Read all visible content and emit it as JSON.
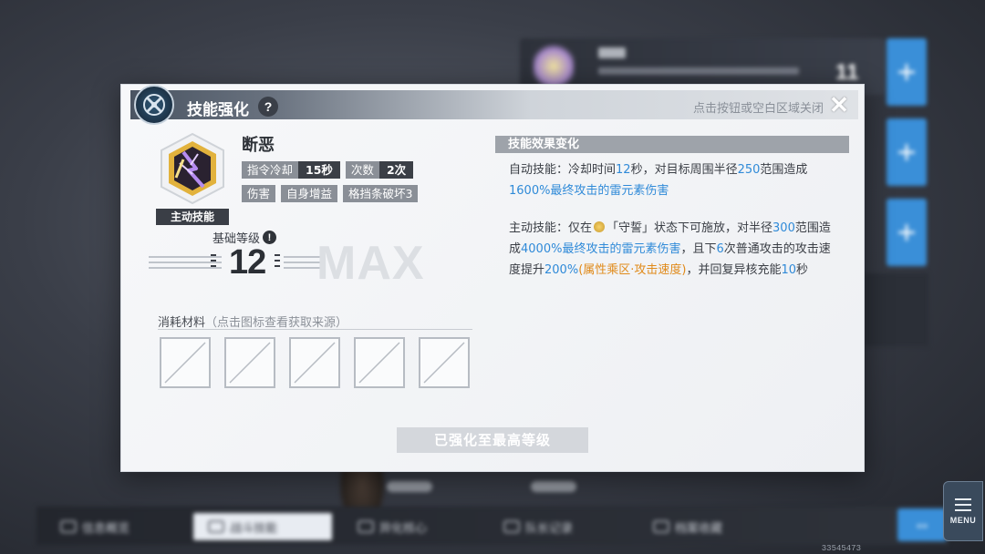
{
  "modal": {
    "title": "技能强化",
    "help_symbol": "?",
    "close_hint": "点击按钮或空白区域关闭",
    "close_symbol": "✕"
  },
  "skill": {
    "name": "断恶",
    "type_badge": "主动技能",
    "tags_row1": [
      {
        "key": "指令冷却",
        "value": "15秒"
      },
      {
        "key": "次数",
        "value": "2次"
      }
    ],
    "tags_row2": [
      "伤害",
      "自身增益",
      "格挡条破坏3"
    ],
    "level_label": "基础等级",
    "level_warn": "!",
    "level_value": "12",
    "level_max": "MAX"
  },
  "materials": {
    "title": "消耗材料",
    "subtitle": "（点击图标查看获取来源）",
    "slot_count": 5
  },
  "effect": {
    "header": "技能效果变化",
    "auto": {
      "p1": "自动技能：冷却时间",
      "cd": "12",
      "p2": "秒，对目标周围半径",
      "radius": "250",
      "p3": "范围造成",
      "dmg": "1600%最终攻击的雷元素伤害"
    },
    "active": {
      "p1": "主动技能：仅在",
      "p2": "「守誓」状态下可施放，对半径",
      "radius": "300",
      "p3": "范围造成",
      "dmg": "4000%最终攻击的雷元素伤害",
      "p4": "，且下",
      "hits": "6",
      "p5": "次普通攻击的攻击速度提升",
      "speed": "200%",
      "bonus": "(属性乘区·攻击速度)",
      "p6": "，并回复异核充能",
      "recover": "10",
      "p7": "秒"
    }
  },
  "maxed_button": "已强化至最高等级",
  "background": {
    "top_card_number": "11",
    "tabs": [
      "信息概览",
      "战斗技能",
      "异化核心",
      "队长记录",
      "档案收藏"
    ],
    "active_tab_index": 1,
    "menu_label": "MENU",
    "footer_code": "33545473"
  },
  "colors": {
    "accent_blue": "#2f8ad8",
    "accent_orange": "#e08a1a",
    "modal_bg": "#f3f4f6"
  }
}
